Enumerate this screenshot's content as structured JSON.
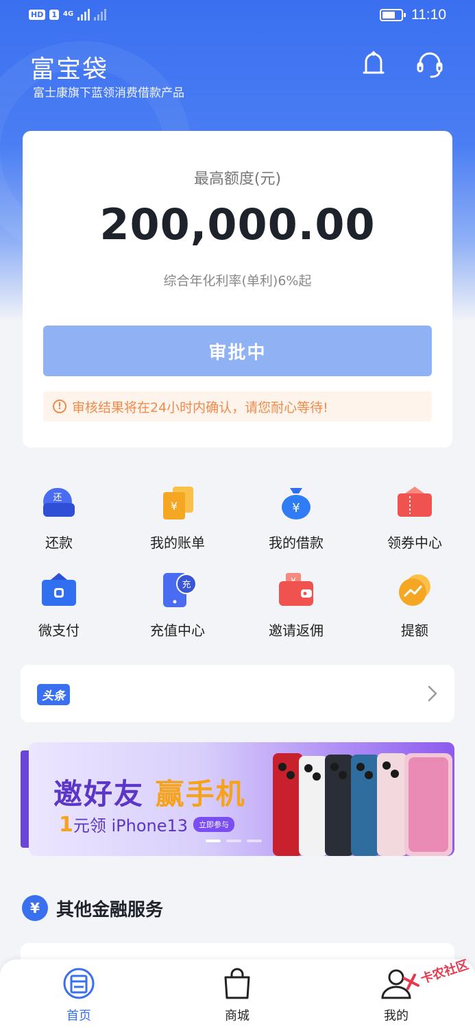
{
  "status_bar": {
    "hd": "HD",
    "sim": "1",
    "network": "4G",
    "time": "11:10"
  },
  "header": {
    "title": "富宝袋",
    "subtitle": "富士康旗下蓝领消费借款产品"
  },
  "quota": {
    "label": "最高额度(元)",
    "amount": "200,000.00",
    "rate": "综合年化利率(单利)6%起",
    "status_button": "审批中",
    "notice": "审核结果将在24小时内确认，请您耐心等待!"
  },
  "quick_actions": [
    {
      "label": "还款",
      "icon": "repay-icon",
      "color": "#4a6cf0"
    },
    {
      "label": "我的账单",
      "icon": "bill-icon",
      "color": "#f5a623"
    },
    {
      "label": "我的借款",
      "icon": "moneybag-icon",
      "color": "#2f7cf5"
    },
    {
      "label": "领券中心",
      "icon": "coupon-icon",
      "color": "#f0534f"
    },
    {
      "label": "微支付",
      "icon": "micropay-icon",
      "color": "#2f6ff0"
    },
    {
      "label": "充值中心",
      "icon": "recharge-icon",
      "color": "#4a6cf0"
    },
    {
      "label": "邀请返佣",
      "icon": "wallet-icon",
      "color": "#f0534f"
    },
    {
      "label": "提额",
      "icon": "raise-limit-icon",
      "color": "#f5a623"
    }
  ],
  "headline": {
    "tag": "头条"
  },
  "banner": {
    "line1_a": "邀好友",
    "line1_b": "赢手机",
    "line2_num": "1",
    "line2_text": "元领 iPhone13",
    "pill": "立即参与"
  },
  "other_services": {
    "icon_text": "¥",
    "title": "其他金融服务"
  },
  "tabbar": {
    "items": [
      {
        "label": "首页",
        "icon": "home-icon"
      },
      {
        "label": "商城",
        "icon": "shop-bag-icon"
      },
      {
        "label": "我的",
        "icon": "user-icon"
      }
    ]
  },
  "watermark": "卡农社区",
  "colors": {
    "primary": "#3a6ff0",
    "button_disabled": "#8fb2f5",
    "notice_text": "#f08a4b",
    "notice_bg": "#fff4ec"
  }
}
